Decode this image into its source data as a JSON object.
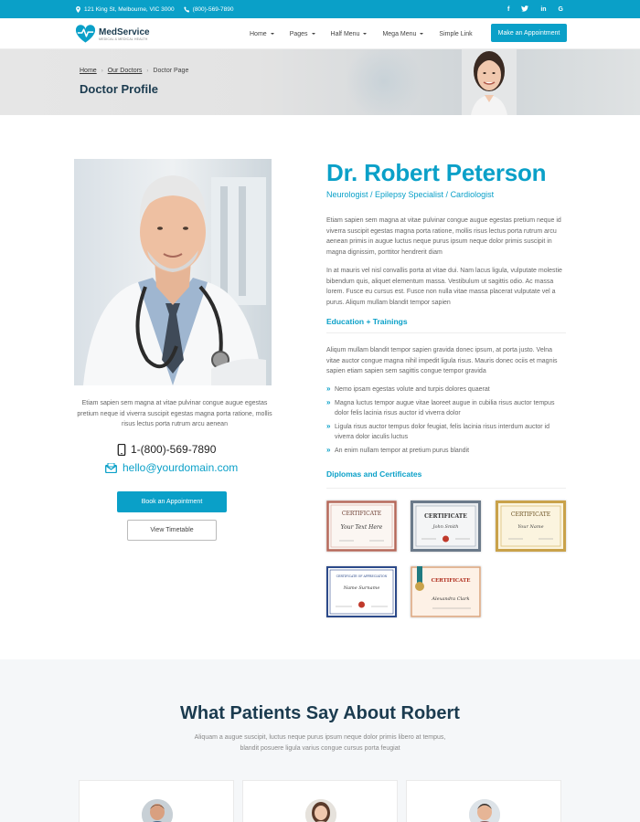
{
  "topbar": {
    "address": "121 King St, Melbourne, VIC 3000",
    "phone": "(800)-569-7890",
    "social": [
      "f",
      "t",
      "in",
      "G"
    ]
  },
  "header": {
    "logo_name": "MedService",
    "logo_tagline": "MEDICAL & MEDICAL HEALTH",
    "nav": [
      {
        "label": "Home",
        "has_caret": true
      },
      {
        "label": "Pages",
        "has_caret": true
      },
      {
        "label": "Half Menu",
        "has_caret": true
      },
      {
        "label": "Mega Menu",
        "has_caret": true
      },
      {
        "label": "Simple Link",
        "has_caret": false
      }
    ],
    "cta": "Make an Appointment"
  },
  "page_header": {
    "breadcrumb": [
      "Home",
      "Our Doctors",
      "Doctor Page"
    ],
    "title": "Doctor Profile"
  },
  "doctor": {
    "bio": "Etiam sapien sem magna at vitae pulvinar congue augue egestas pretium neque id viverra suscipit egestas magna porta ratione, mollis risus lectus porta rutrum arcu aenean",
    "phone": "1-(800)-569-7890",
    "email": "hello@yourdomain.com",
    "book_button": "Book an Appointment",
    "timetable_button": "View Timetable",
    "name": "Dr. Robert Peterson",
    "specialties": "Neurologist / Epilepsy Specialist / Cardiologist",
    "para1": "Etiam sapien sem magna at vitae pulvinar congue augue egestas pretium neque id viverra suscipit egestas magna porta ratione, mollis risus lectus porta rutrum arcu aenean primis in augue luctus neque purus ipsum neque dolor primis suscipit in magna dignissim, porttitor hendrerit diam",
    "para2": "In at mauris vel nisl convallis porta at vitae dui. Nam lacus ligula, vulputate molestie bibendum quis, aliquet elementum massa. Vestibulum ut sagittis odio. Ac massa lorem. Fusce eu cursus est. Fusce non nulla vitae massa placerat vulputate vel a purus. Aliqum mullam blandit tempor sapien",
    "education_title": "Education + Trainings",
    "education_text": "Aliqum mullam blandit tempor sapien gravida donec ipsum, at porta justo. Velna vitae auctor congue magna nihil impedit ligula risus. Mauris donec ociis et magnis sapien etiam sapien sem sagittis congue tempor gravida",
    "education_points": [
      "Nemo ipsam egestas volute and turpis dolores quaerat",
      "Magna luctus tempor augue vitae laoreet augue in cubilia risus auctor tempus dolor felis lacinia risus auctor id viverra dolor",
      "Ligula risus auctor tempus dolor feugiat, felis lacinia risus interdum auctor id viverra dolor iaculis luctus",
      "An enim nullam tempor at pretium purus blandit"
    ],
    "diplomas_title": "Diplomas and Certificates"
  },
  "certificates": [
    {
      "heading": "CERTIFICATE",
      "signature": "Your Text Here",
      "frame": "#b5685a"
    },
    {
      "heading": "CERTIFICATE",
      "signature": "John Smith",
      "frame": "#6b7a8a"
    },
    {
      "heading": "CERTIFICATE",
      "signature": "Your Name",
      "frame": "#c9a24a"
    },
    {
      "heading": "CERTIFICATE OF APPRECIATION",
      "signature": "Name Surname",
      "frame": "#2c4a8a"
    },
    {
      "heading": "CERTIFICATE",
      "signature": "Alexandra Clark",
      "frame": "#d9a27a"
    }
  ],
  "testimonials": {
    "title": "What Patients Say About Robert",
    "subtitle": "Aliquam a augue suscipit, luctus neque purus ipsum neque dolor primis libero at tempus, blandit posuere ligula varius congue cursus porta feugiat"
  },
  "colors": {
    "accent": "#0aa0c8",
    "heading": "#1b3b4f"
  }
}
